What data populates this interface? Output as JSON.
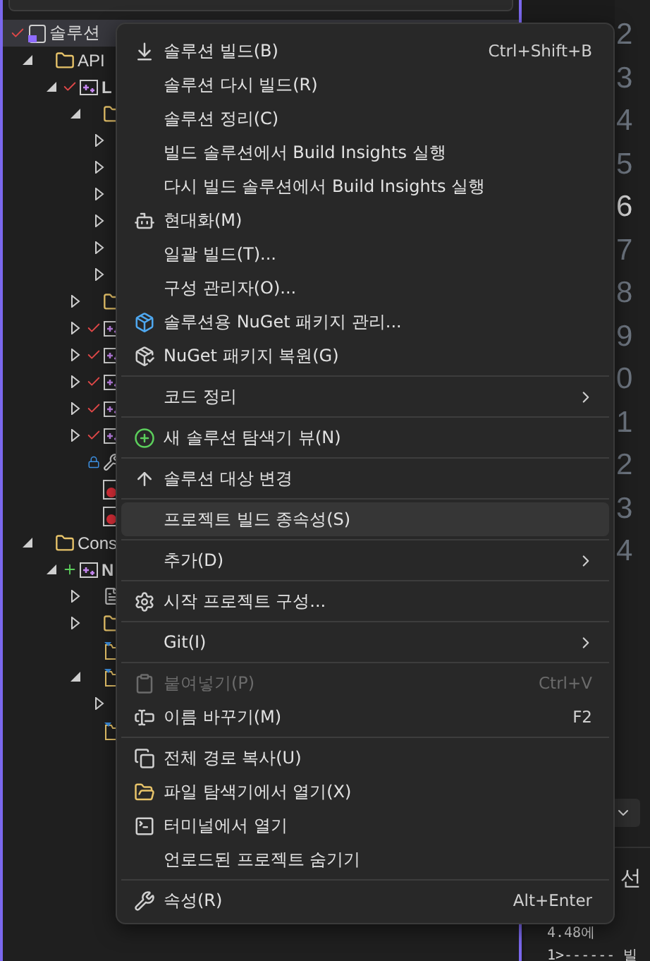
{
  "solution_explorer": {
    "tree": [
      {
        "kind": "solution",
        "label": "솔루션",
        "pending_edit": true,
        "selected": true,
        "children": [
          {
            "kind": "folder",
            "label": "API",
            "expanded": true,
            "children": [
              {
                "kind": "project",
                "label": "L",
                "pending_edit": true,
                "expanded": true,
                "children": [
                  {
                    "kind": "folder",
                    "expanded": true,
                    "children": [
                      {
                        "expanded": false
                      },
                      {
                        "expanded": false
                      },
                      {
                        "expanded": false
                      },
                      {
                        "expanded": false
                      },
                      {
                        "expanded": false
                      },
                      {
                        "expanded": false
                      }
                    ]
                  },
                  {
                    "kind": "folder",
                    "expanded": false
                  },
                  {
                    "kind": "project",
                    "pending_edit": true,
                    "expanded": false
                  },
                  {
                    "kind": "project",
                    "pending_edit": true,
                    "expanded": false
                  },
                  {
                    "kind": "project",
                    "pending_edit": true,
                    "expanded": false
                  },
                  {
                    "kind": "project",
                    "pending_edit": true,
                    "expanded": false
                  },
                  {
                    "kind": "project",
                    "pending_edit": true,
                    "expanded": false
                  },
                  {
                    "kind": "wrench"
                  },
                  {
                    "kind": "error-file"
                  },
                  {
                    "kind": "error-file"
                  }
                ]
              }
            ]
          },
          {
            "kind": "folder",
            "label": "Cons",
            "expanded": true,
            "children": [
              {
                "kind": "project",
                "label": "N",
                "pending_add": true,
                "expanded": true,
                "children": [
                  {
                    "kind": "file",
                    "expanded": false
                  },
                  {
                    "kind": "folder",
                    "expanded": false
                  },
                  {
                    "kind": "filter-folder"
                  },
                  {
                    "kind": "filter-folder",
                    "expanded": true,
                    "children": [
                      {
                        "expanded": false
                      }
                    ]
                  },
                  {
                    "kind": "filter-folder"
                  }
                ]
              }
            ]
          }
        ]
      }
    ]
  },
  "editor": {
    "line_numbers": [
      {
        "text": "2",
        "current": false
      },
      {
        "text": "3",
        "current": false
      },
      {
        "text": "4",
        "current": false
      },
      {
        "text": "5",
        "current": false
      },
      {
        "text": "6",
        "current": true
      },
      {
        "text": "7",
        "current": false
      },
      {
        "text": "8",
        "current": false
      },
      {
        "text": "9",
        "current": false
      },
      {
        "text": "0",
        "current": false
      },
      {
        "text": "1",
        "current": false
      },
      {
        "text": "2",
        "current": false
      },
      {
        "text": "3",
        "current": false
      },
      {
        "text": "4",
        "current": false
      }
    ]
  },
  "output": {
    "lines": [
      "선",
      "4.48에",
      "1>------ 빌"
    ]
  },
  "context_menu": {
    "items": [
      {
        "kind": "item",
        "label": "솔루션 빌드(B)",
        "shortcut": "Ctrl+Shift+B",
        "selected": false,
        "disabled": false
      },
      {
        "kind": "item",
        "label": "솔루션 다시 빌드(R)",
        "selected": false,
        "disabled": false
      },
      {
        "kind": "item",
        "label": "솔루션 정리(C)",
        "selected": false,
        "disabled": false
      },
      {
        "kind": "item",
        "label": "빌드 솔루션에서 Build Insights 실행",
        "selected": false,
        "disabled": false
      },
      {
        "kind": "item",
        "label": "다시 빌드 솔루션에서 Build Insights 실행",
        "selected": false,
        "disabled": false
      },
      {
        "kind": "item",
        "label": "현대화(M)",
        "selected": false,
        "disabled": false
      },
      {
        "kind": "item",
        "label": "일괄 빌드(T)...",
        "selected": false,
        "disabled": false
      },
      {
        "kind": "item",
        "label": "구성 관리자(O)...",
        "selected": false,
        "disabled": false
      },
      {
        "kind": "item",
        "label": "솔루션용 NuGet 패키지 관리...",
        "selected": false,
        "disabled": false
      },
      {
        "kind": "item",
        "label": "NuGet 패키지 복원(G)",
        "selected": false,
        "disabled": false
      },
      {
        "kind": "separator"
      },
      {
        "kind": "submenu",
        "label": "코드 정리",
        "selected": false,
        "disabled": false
      },
      {
        "kind": "separator"
      },
      {
        "kind": "item",
        "label": "새 솔루션 탐색기 뷰(N)",
        "selected": false,
        "disabled": false
      },
      {
        "kind": "separator"
      },
      {
        "kind": "item",
        "label": "솔루션 대상 변경",
        "selected": false,
        "disabled": false
      },
      {
        "kind": "separator"
      },
      {
        "kind": "item",
        "label": "프로젝트 빌드 종속성(S)",
        "selected": true,
        "disabled": false
      },
      {
        "kind": "separator"
      },
      {
        "kind": "submenu",
        "label": "추가(D)",
        "selected": false,
        "disabled": false
      },
      {
        "kind": "separator"
      },
      {
        "kind": "item",
        "label": "시작 프로젝트 구성...",
        "selected": false,
        "disabled": false
      },
      {
        "kind": "separator"
      },
      {
        "kind": "submenu",
        "label": "Git(I)",
        "selected": false,
        "disabled": false
      },
      {
        "kind": "separator"
      },
      {
        "kind": "item",
        "label": "붙여넣기(P)",
        "shortcut": "Ctrl+V",
        "selected": false,
        "disabled": true
      },
      {
        "kind": "item",
        "label": "이름 바꾸기(M)",
        "shortcut": "F2",
        "selected": false,
        "disabled": false
      },
      {
        "kind": "separator"
      },
      {
        "kind": "item",
        "label": "전체 경로 복사(U)",
        "selected": false,
        "disabled": false
      },
      {
        "kind": "item",
        "label": "파일 탐색기에서 열기(X)",
        "selected": false,
        "disabled": false
      },
      {
        "kind": "item",
        "label": "터미널에서 열기",
        "selected": false,
        "disabled": false
      },
      {
        "kind": "item",
        "label": "언로드된 프로젝트 숨기기",
        "selected": false,
        "disabled": false
      },
      {
        "kind": "separator"
      },
      {
        "kind": "item",
        "label": "속성(R)",
        "shortcut": "Alt+Enter",
        "selected": false,
        "disabled": false
      }
    ]
  }
}
